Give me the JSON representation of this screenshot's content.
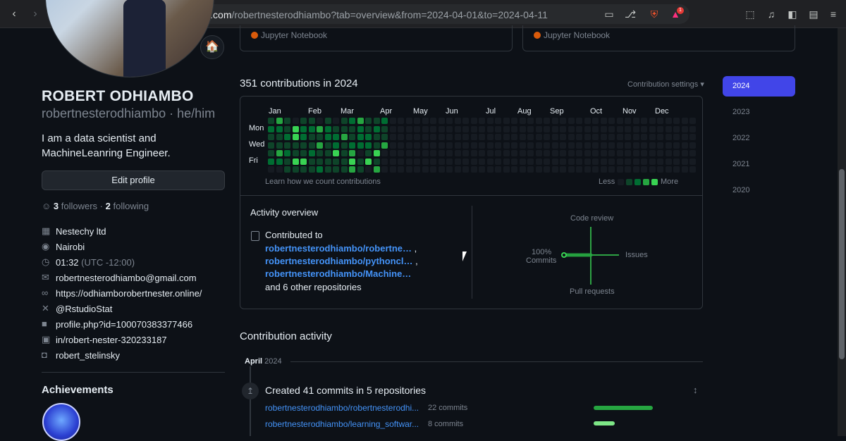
{
  "browser": {
    "url_host": "github.com",
    "url_path": "/robertnesterodhiambo?tab=overview&from=2024-04-01&to=2024-04-11",
    "badge_count": "1"
  },
  "profile": {
    "status_emoji": "🏠",
    "name": "ROBERT ODHIAMBO",
    "login_pronouns": "robertnesterodhiambo · he/him",
    "bio": "I am a data scientist and MachineLeanring Engineer.",
    "edit_button": "Edit profile",
    "followers_count": "3",
    "followers_label": "followers",
    "following_count": "2",
    "following_label": "following",
    "details": [
      {
        "icon": "organization-icon",
        "text": "Nestechy ltd"
      },
      {
        "icon": "location-icon",
        "text": "Nairobi"
      },
      {
        "icon": "clock-icon",
        "text": "01:32",
        "muted": "(UTC -12:00)"
      },
      {
        "icon": "mail-icon",
        "text": "robertnesterodhiambo@gmail.com"
      },
      {
        "icon": "link-icon",
        "text": "https://odhiamborobertnester.online/"
      },
      {
        "icon": "x-icon",
        "text": "@RstudioStat"
      },
      {
        "icon": "facebook-icon",
        "text": "profile.php?id=100070383377466"
      },
      {
        "icon": "linkedin-icon",
        "text": "in/robert-nester-320233187"
      },
      {
        "icon": "instagram-icon",
        "text": "robert_stelinsky"
      }
    ],
    "achievements_title": "Achievements"
  },
  "pinned": [
    {
      "language": "Jupyter Notebook",
      "color": "#da5b0b"
    },
    {
      "language": "Jupyter Notebook",
      "color": "#da5b0b"
    }
  ],
  "contributions": {
    "title": "351 contributions in 2024",
    "settings_label": "Contribution settings ▾",
    "months": [
      "Jan",
      "Feb",
      "Mar",
      "Apr",
      "May",
      "Jun",
      "Jul",
      "Aug",
      "Sep",
      "Oct",
      "Nov",
      "Dec"
    ],
    "day_labels": [
      "Mon",
      "Wed",
      "Fri"
    ],
    "learn_link": "Learn how we count contributions",
    "legend_less": "Less",
    "legend_more": "More",
    "level_colors": [
      "#161b22",
      "#0e4429",
      "#006d32",
      "#26a641",
      "#39d353"
    ]
  },
  "activity_overview": {
    "title": "Activity overview",
    "contributed_to": "Contributed to",
    "repos": [
      "robertnesterodhiambo/robertne…",
      "robertnesterodhiambo/pythoncl…",
      "robertnesterodhiambo/Machine…"
    ],
    "others": "and 6 other repositories",
    "axis": {
      "top": "Code review",
      "right": "Issues",
      "bottom": "Pull requests",
      "left_pct": "100%",
      "left_label": "Commits"
    }
  },
  "years": [
    "2024",
    "2023",
    "2022",
    "2021",
    "2020"
  ],
  "contribution_activity": {
    "title": "Contribution activity",
    "month": "April",
    "year": "2024",
    "commits_title": "Created 41 commits in 5 repositories",
    "repos": [
      {
        "name": "robertnesterodhiambo/robertnesterodhi...",
        "count": "22 commits",
        "fraction": 1.0
      },
      {
        "name": "robertnesterodhiambo/learning_softwar...",
        "count": "8 commits",
        "fraction": 0.36
      }
    ]
  }
}
